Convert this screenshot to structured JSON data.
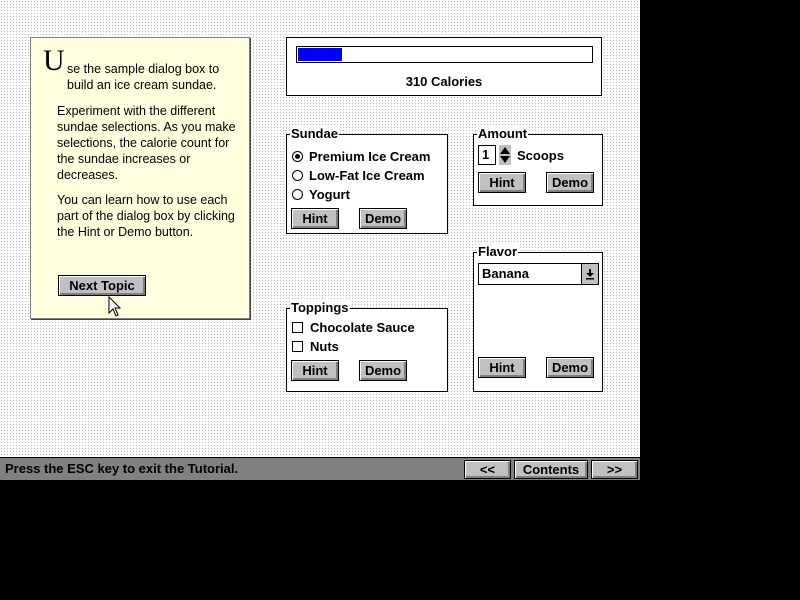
{
  "intro": {
    "dropcap": "U",
    "paragraph1": "se the sample dialog box to build an ice cream sundae.",
    "paragraph2": "Experiment with the different sundae selections. As you make selections, the calorie count for the sundae increases or decreases.",
    "paragraph3": "You can learn how to use each part of the dialog box by clicking the Hint or Demo button.",
    "next_topic": "Next Topic"
  },
  "calories": {
    "label": "310 Calories",
    "fill_fraction": 0.15,
    "fill_color": "#0000ff"
  },
  "sundae": {
    "title": "Sundae",
    "options": [
      "Premium Ice Cream",
      "Low-Fat Ice Cream",
      "Yogurt"
    ],
    "selected": 0,
    "hint": "Hint",
    "demo": "Demo"
  },
  "amount": {
    "title": "Amount",
    "value": "1",
    "unit": "Scoops",
    "hint": "Hint",
    "demo": "Demo"
  },
  "flavor": {
    "title": "Flavor",
    "selected": "Banana",
    "hint": "Hint",
    "demo": "Demo"
  },
  "toppings": {
    "title": "Toppings",
    "options": [
      "Chocolate Sauce",
      "Nuts"
    ],
    "hint": "Hint",
    "demo": "Demo"
  },
  "status": {
    "text": "Press the ESC key to exit the Tutorial.",
    "prev": "<<",
    "contents": "Contents",
    "next": ">>"
  }
}
